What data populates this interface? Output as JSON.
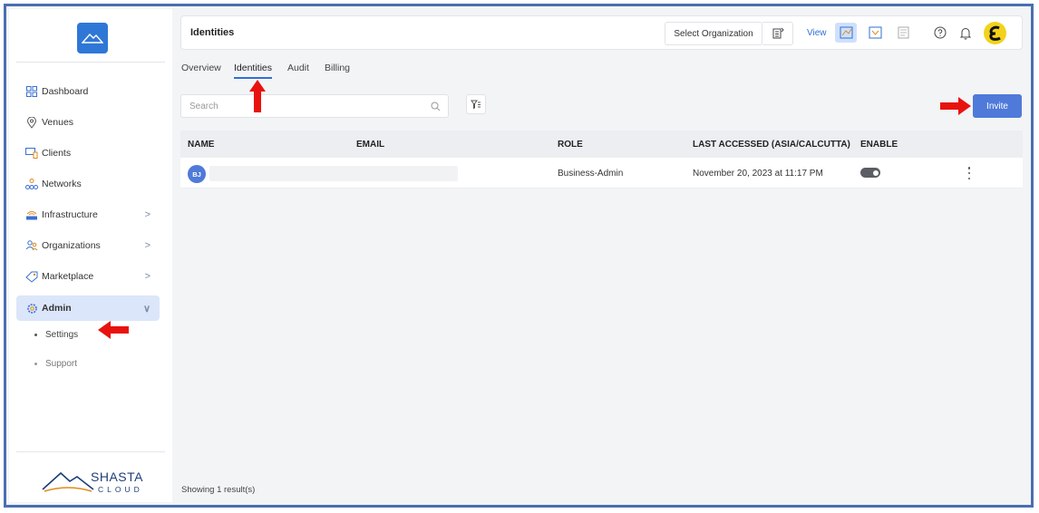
{
  "sidebar": {
    "items": [
      {
        "label": "Dashboard",
        "icon": "dashboard-icon"
      },
      {
        "label": "Venues",
        "icon": "location-pin-icon"
      },
      {
        "label": "Clients",
        "icon": "clients-icon"
      },
      {
        "label": "Networks",
        "icon": "network-icon"
      },
      {
        "label": "Infrastructure",
        "icon": "router-icon",
        "chevron": ">"
      },
      {
        "label": "Organizations",
        "icon": "organizations-icon",
        "chevron": ">"
      },
      {
        "label": "Marketplace",
        "icon": "tag-icon",
        "chevron": ">"
      },
      {
        "label": "Admin",
        "icon": "gear-icon",
        "chevron": "∨",
        "active": true
      }
    ],
    "sub_items": [
      {
        "label": "Settings"
      },
      {
        "label": "Support"
      }
    ],
    "brand": {
      "name": "SHASTA",
      "tagline": "CLOUD"
    }
  },
  "header": {
    "title": "Identities",
    "org_select": "Select Organization",
    "view_label": "View"
  },
  "tabs": [
    {
      "label": "Overview"
    },
    {
      "label": "Identities",
      "active": true
    },
    {
      "label": "Audit"
    },
    {
      "label": "Billing"
    }
  ],
  "search": {
    "placeholder": "Search"
  },
  "invite_label": "Invite",
  "table": {
    "columns": [
      "NAME",
      "EMAIL",
      "ROLE",
      "LAST ACCESSED (ASIA/CALCUTTA)",
      "ENABLE"
    ],
    "rows": [
      {
        "initials": "BJ",
        "role": "Business-Admin",
        "last_accessed": "November 20, 2023 at 11:17 PM",
        "enabled": true
      }
    ]
  },
  "footer": {
    "result_text": "Showing 1 result(s)"
  },
  "colors": {
    "accent": "#4f7ad9",
    "frame": "#4a6fb0",
    "annotation": "#e8130f",
    "avatar": "#f2d21b"
  }
}
